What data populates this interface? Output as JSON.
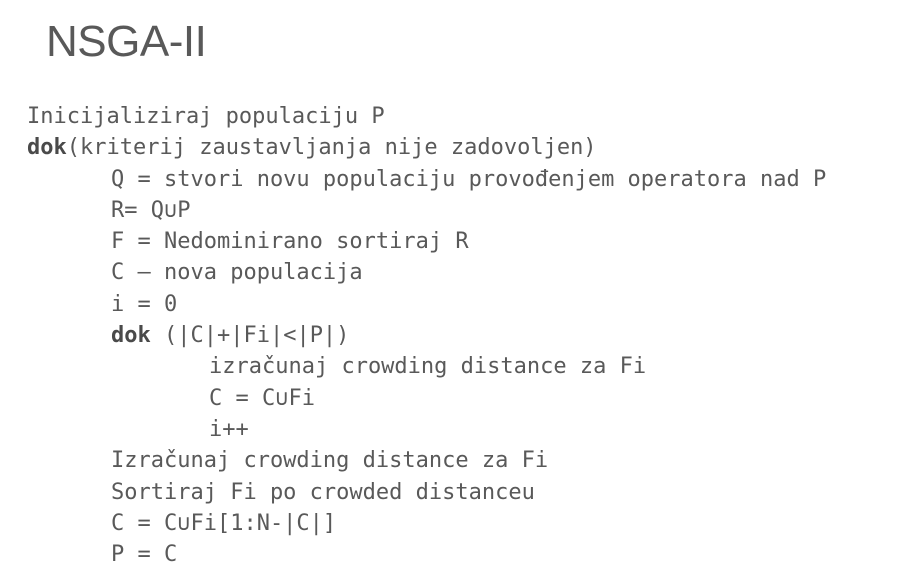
{
  "slide": {
    "title": "NSGA-II"
  },
  "pseudocode": {
    "lines": [
      {
        "indent": 0,
        "keyword": "",
        "text": "Inicijaliziraj populaciju P"
      },
      {
        "indent": 0,
        "keyword": "dok",
        "text": "(kriterij zaustavljanja nije zadovoljen)"
      },
      {
        "indent": 1,
        "keyword": "",
        "text": "Q = stvori novu populaciju provođenjem operatora nad P"
      },
      {
        "indent": 1,
        "keyword": "",
        "text": "R= Q∪P"
      },
      {
        "indent": 1,
        "keyword": "",
        "text": "F = Nedominirano sortiraj R"
      },
      {
        "indent": 1,
        "keyword": "",
        "text": "C – nova populacija"
      },
      {
        "indent": 1,
        "keyword": "",
        "text": "i = 0"
      },
      {
        "indent": 1,
        "keyword": "dok",
        "text": " (|C|+|Fi|<|P|)"
      },
      {
        "indent": 2,
        "keyword": "",
        "text": "izračunaj crowding distance za Fi"
      },
      {
        "indent": 2,
        "keyword": "",
        "text": "C = C∪Fi"
      },
      {
        "indent": 2,
        "keyword": "",
        "text": "i++"
      },
      {
        "indent": 1,
        "keyword": "",
        "text": "Izračunaj crowding distance za Fi"
      },
      {
        "indent": 1,
        "keyword": "",
        "text": "Sortiraj Fi po crowded distanceu"
      },
      {
        "indent": 1,
        "keyword": "",
        "text": "C = C∪Fi[1:N-|C|]"
      },
      {
        "indent": 1,
        "keyword": "",
        "text": "P = C"
      }
    ]
  }
}
